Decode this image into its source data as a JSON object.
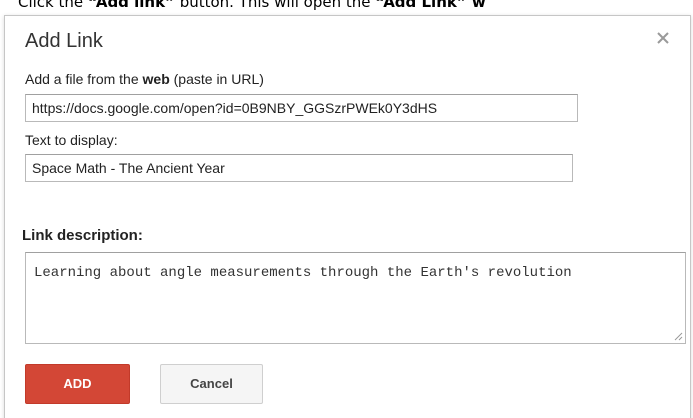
{
  "instruction": {
    "pre": "Click the ",
    "add_link_bold": "“Add link”",
    "mid": " button. This will open the ",
    "add_link_window_bold": "“Add Link” w"
  },
  "dialog": {
    "title": "Add Link",
    "close_icon": "close-icon",
    "url_label_pre": "Add a file from the ",
    "url_label_bold": "web",
    "url_label_post": " (paste in URL)",
    "url_value": "https://docs.google.com/open?id=0B9NBY_GGSzrPWEk0Y3dHS",
    "display_label": "Text to display:",
    "display_value": "Space Math - The Ancient Year",
    "description_label": "Link description:",
    "description_value": "Learning about angle measurements through the Earth's revolution",
    "add_button": "ADD",
    "cancel_button": "Cancel"
  },
  "colors": {
    "add_button": "#d34736",
    "cancel_button": "#f5f5f5"
  }
}
